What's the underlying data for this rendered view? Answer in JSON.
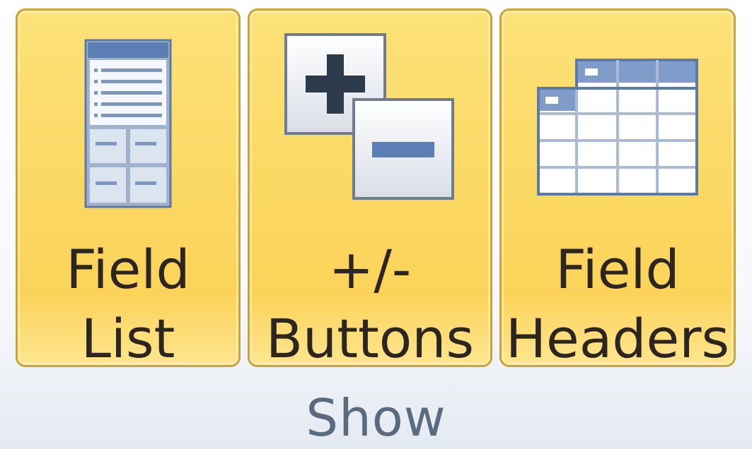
{
  "ribbon": {
    "group_label": "Show",
    "buttons": [
      {
        "line1": "Field",
        "line2": "List",
        "icon": "field-list-icon",
        "state": "selected"
      },
      {
        "line1": "+/-",
        "line2": "Buttons",
        "icon": "plus-minus-buttons-icon",
        "state": "selected"
      },
      {
        "line1": "Field",
        "line2": "Headers",
        "icon": "field-headers-icon",
        "state": "selected"
      }
    ]
  },
  "colors": {
    "button_fill": "#fbd965",
    "button_border": "#c9a43d",
    "label_text": "#2d2620",
    "group_label_text": "#5a6b80",
    "icon_blue": "#5b7fb5"
  }
}
